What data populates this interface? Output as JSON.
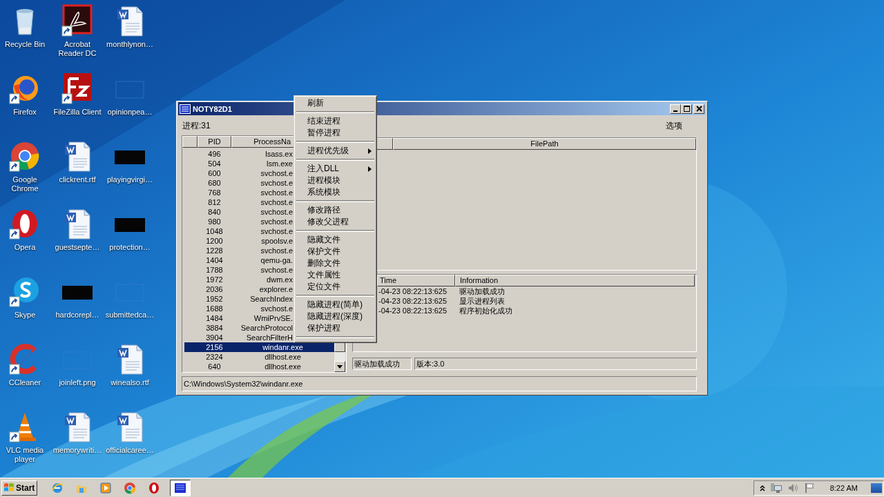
{
  "desktop": {
    "icons": [
      {
        "label": "Recycle Bin",
        "kind": "recycle",
        "shortcut": false
      },
      {
        "label": "Acrobat Reader DC",
        "kind": "acrobat",
        "shortcut": true
      },
      {
        "label": "monthlynon…",
        "kind": "word",
        "shortcut": false
      },
      {
        "label": "Firefox",
        "kind": "firefox",
        "shortcut": true
      },
      {
        "label": "FileZilla Client",
        "kind": "filezilla",
        "shortcut": true
      },
      {
        "label": "opinionpea…",
        "kind": "blank",
        "shortcut": false
      },
      {
        "label": "Google Chrome",
        "kind": "chrome",
        "shortcut": true
      },
      {
        "label": "clickrent.rtf",
        "kind": "word",
        "shortcut": false
      },
      {
        "label": "playingvirgi…",
        "kind": "dark",
        "shortcut": false
      },
      {
        "label": "Opera",
        "kind": "opera",
        "shortcut": true
      },
      {
        "label": "guestsepte…",
        "kind": "word",
        "shortcut": false
      },
      {
        "label": "protection…",
        "kind": "dark",
        "shortcut": false
      },
      {
        "label": "Skype",
        "kind": "skype",
        "shortcut": true
      },
      {
        "label": "hardcorepl…",
        "kind": "dark",
        "shortcut": false
      },
      {
        "label": "submittedca…",
        "kind": "blank",
        "shortcut": false
      },
      {
        "label": "CCleaner",
        "kind": "ccleaner",
        "shortcut": true
      },
      {
        "label": "joinleft.png",
        "kind": "blank",
        "shortcut": false
      },
      {
        "label": "winealso.rtf",
        "kind": "word",
        "shortcut": false
      },
      {
        "label": "VLC media player",
        "kind": "vlc",
        "shortcut": true
      },
      {
        "label": "memorywriti…",
        "kind": "word",
        "shortcut": false
      },
      {
        "label": "officialcaree…",
        "kind": "word",
        "shortcut": false
      }
    ]
  },
  "window": {
    "title": "NOTY82D1",
    "process_count": "进程:31",
    "options": "选项",
    "process_list": {
      "columns": [
        "PID",
        "ProcessNa"
      ],
      "rows": [
        {
          "pid": "496",
          "name": "lsass.ex",
          "covered": true,
          "selected": false
        },
        {
          "pid": "504",
          "name": "lsm.exe",
          "covered": true,
          "selected": false
        },
        {
          "pid": "600",
          "name": "svchost.e",
          "covered": true,
          "selected": false
        },
        {
          "pid": "680",
          "name": "svchost.e",
          "covered": true,
          "selected": false
        },
        {
          "pid": "768",
          "name": "svchost.e",
          "covered": true,
          "selected": false
        },
        {
          "pid": "812",
          "name": "svchost.e",
          "covered": true,
          "selected": false
        },
        {
          "pid": "840",
          "name": "svchost.e",
          "covered": true,
          "selected": false
        },
        {
          "pid": "980",
          "name": "svchost.e",
          "covered": true,
          "selected": false
        },
        {
          "pid": "1048",
          "name": "svchost.e",
          "covered": true,
          "selected": false
        },
        {
          "pid": "1200",
          "name": "spoolsv.e",
          "covered": true,
          "selected": false
        },
        {
          "pid": "1228",
          "name": "svchost.e",
          "covered": true,
          "selected": false
        },
        {
          "pid": "1404",
          "name": "qemu-ga.",
          "covered": true,
          "selected": false
        },
        {
          "pid": "1788",
          "name": "svchost.e",
          "covered": true,
          "selected": false
        },
        {
          "pid": "1972",
          "name": "dwm.ex",
          "covered": true,
          "selected": false
        },
        {
          "pid": "2036",
          "name": "explorer.e",
          "covered": true,
          "selected": false
        },
        {
          "pid": "1952",
          "name": "SearchIndex",
          "covered": true,
          "selected": false
        },
        {
          "pid": "1688",
          "name": "svchost.e",
          "covered": true,
          "selected": false
        },
        {
          "pid": "1484",
          "name": "WmiPrvSE.",
          "covered": true,
          "selected": false
        },
        {
          "pid": "3884",
          "name": "SearchProtocol",
          "covered": true,
          "selected": false
        },
        {
          "pid": "3904",
          "name": "SearchFilterH",
          "covered": true,
          "selected": false
        },
        {
          "pid": "2156",
          "name": "windanr.exe",
          "covered": false,
          "selected": true
        },
        {
          "pid": "2324",
          "name": "dllhost.exe",
          "covered": false,
          "selected": false
        },
        {
          "pid": "640",
          "name": "dllhost.exe",
          "covered": false,
          "selected": false
        }
      ]
    },
    "module_list": {
      "columns": [
        "FilePath"
      ]
    },
    "log": {
      "columns": [
        "Time",
        "Information"
      ],
      "rows": [
        {
          "time": "-04-23 08:22:13:625",
          "info": "驱动加载成功"
        },
        {
          "time": "-04-23 08:22:13:625",
          "info": "显示进程列表"
        },
        {
          "time": "-04-23 08:22:13:625",
          "info": "程序初始化成功"
        }
      ]
    },
    "status": [
      "驱动加载成功",
      "版本:3.0"
    ],
    "path": "C:\\Windows\\System32\\windanr.exe"
  },
  "context_menu": {
    "items": [
      {
        "kind": "item",
        "label": "刷新",
        "submenu": false
      },
      {
        "kind": "separator"
      },
      {
        "kind": "item",
        "label": "结束进程",
        "submenu": false
      },
      {
        "kind": "item",
        "label": "暂停进程",
        "submenu": false
      },
      {
        "kind": "separator"
      },
      {
        "kind": "item",
        "label": "进程优先级",
        "submenu": true
      },
      {
        "kind": "separator"
      },
      {
        "kind": "item",
        "label": "注入DLL",
        "submenu": true
      },
      {
        "kind": "item",
        "label": "进程模块",
        "submenu": false
      },
      {
        "kind": "item",
        "label": "系统模块",
        "submenu": false
      },
      {
        "kind": "separator"
      },
      {
        "kind": "item",
        "label": "修改路径",
        "submenu": false
      },
      {
        "kind": "item",
        "label": "修改父进程",
        "submenu": false
      },
      {
        "kind": "separator"
      },
      {
        "kind": "item",
        "label": "隐藏文件",
        "submenu": false
      },
      {
        "kind": "item",
        "label": "保护文件",
        "submenu": false
      },
      {
        "kind": "item",
        "label": "删除文件",
        "submenu": false
      },
      {
        "kind": "item",
        "label": "文件属性",
        "submenu": false
      },
      {
        "kind": "item",
        "label": "定位文件",
        "submenu": false
      },
      {
        "kind": "separator"
      },
      {
        "kind": "item",
        "label": "隐藏进程(简单)",
        "submenu": false
      },
      {
        "kind": "item",
        "label": "隐藏进程(深度)",
        "submenu": false
      },
      {
        "kind": "item",
        "label": "保护进程",
        "submenu": false
      },
      {
        "kind": "separator"
      }
    ]
  },
  "taskbar": {
    "start": "Start",
    "apps": [
      {
        "kind": "ie",
        "active": false
      },
      {
        "kind": "explorer",
        "active": false
      },
      {
        "kind": "media",
        "active": false
      },
      {
        "kind": "chrome",
        "active": false
      },
      {
        "kind": "opera",
        "active": false
      },
      {
        "kind": "app",
        "active": true
      }
    ],
    "clock": "8:22 AM"
  }
}
